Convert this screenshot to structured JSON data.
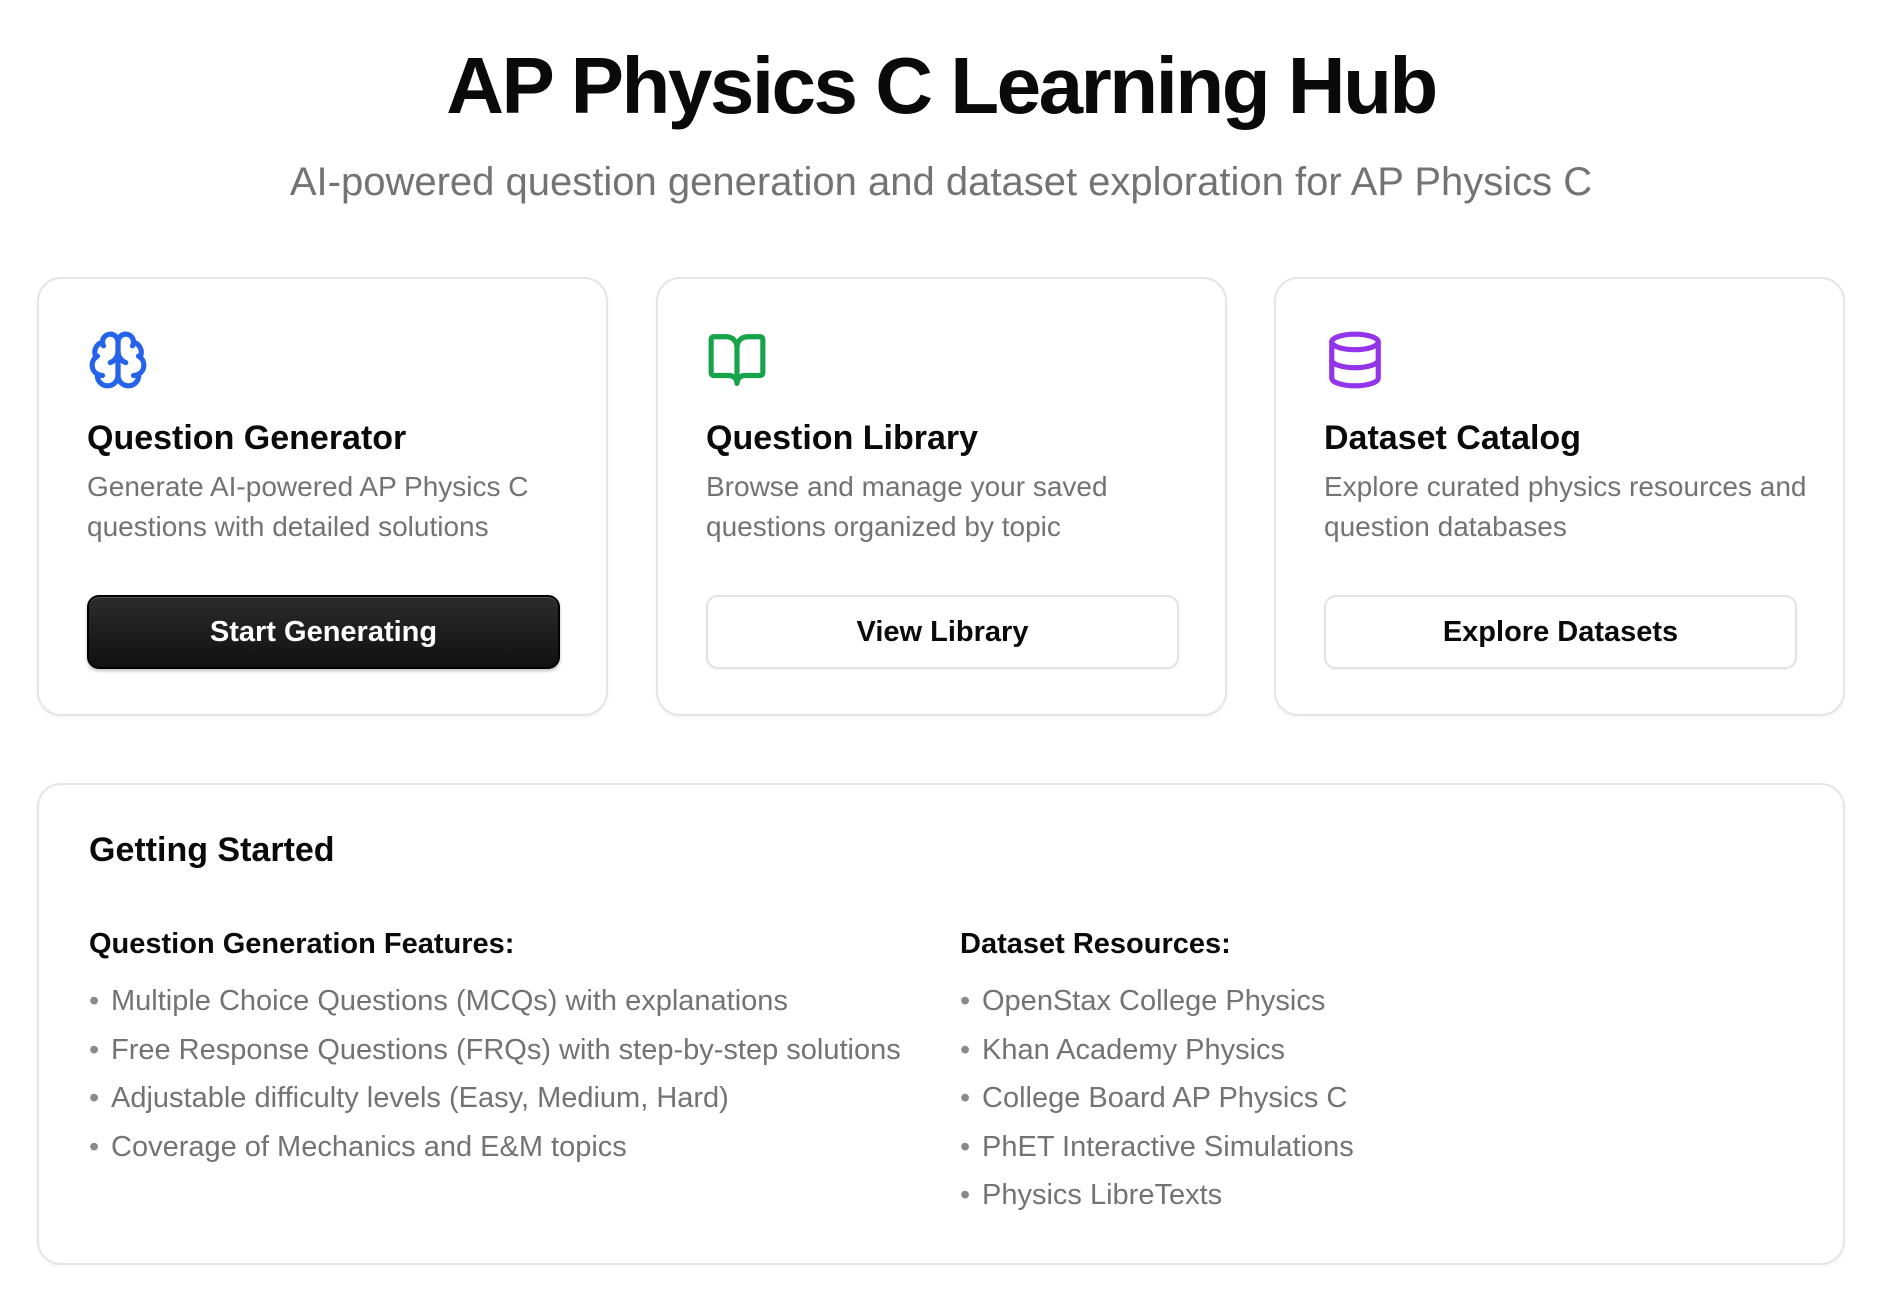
{
  "header": {
    "title": "AP Physics C Learning Hub",
    "subtitle": "AI-powered question generation and dataset exploration for AP Physics C"
  },
  "cards": [
    {
      "icon": "brain-icon",
      "icon_color": "#2563eb",
      "title": "Question Generator",
      "description": "Generate AI-powered AP Physics C questions with detailed solutions",
      "button_label": "Start Generating"
    },
    {
      "icon": "book-open-icon",
      "icon_color": "#16a34a",
      "title": "Question Library",
      "description": "Browse and manage your saved questions organized by topic",
      "button_label": "View Library"
    },
    {
      "icon": "database-icon",
      "icon_color": "#9333ea",
      "title": "Dataset Catalog",
      "description": "Explore curated physics resources and question databases",
      "button_label": "Explore Datasets"
    }
  ],
  "getting_started": {
    "title": "Getting Started",
    "features": {
      "title": "Question Generation Features:",
      "items": [
        "Multiple Choice Questions (MCQs) with explanations",
        "Free Response Questions (FRQs) with step-by-step solutions",
        "Adjustable difficulty levels (Easy, Medium, Hard)",
        "Coverage of Mechanics and E&M topics"
      ]
    },
    "resources": {
      "title": "Dataset Resources:",
      "items": [
        "OpenStax College Physics",
        "Khan Academy Physics",
        "College Board AP Physics C",
        "PhET Interactive Simulations",
        "Physics LibreTexts"
      ]
    }
  }
}
